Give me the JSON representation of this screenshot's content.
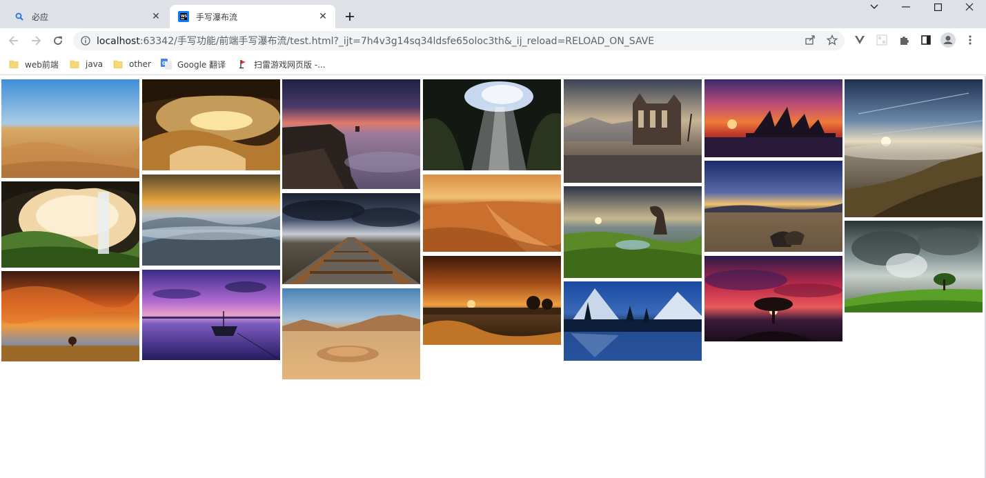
{
  "tabs": [
    {
      "title": "必应",
      "icon": "bing-search-icon"
    },
    {
      "title": "手写瀑布流",
      "icon": "webstorm-icon"
    }
  ],
  "address": {
    "host": "localhost",
    "rest": ":63342/手写功能/前端手写瀑布流/test.html?_ijt=7h4v3g14sq34ldsfe65oloc3th&_ij_reload=RELOAD_ON_SAVE"
  },
  "bookmarks": [
    {
      "label": "web前端",
      "icon": "folder-icon"
    },
    {
      "label": "java",
      "icon": "folder-icon"
    },
    {
      "label": "other",
      "icon": "folder-icon"
    },
    {
      "label": "Google 翻译",
      "icon": "google-translate-icon"
    },
    {
      "label": "扫雷游戏网页版 -...",
      "icon": "minesweeper-flag-icon"
    }
  ],
  "colors": {
    "tabstrip": "#dee1e6",
    "accent": "#1a73e8"
  },
  "gallery": {
    "columns": [
      [
        "desert-dunes",
        "waterfall-cave",
        "sunset-lone-tree"
      ],
      [
        "golden-dunes",
        "misty-valley",
        "purple-lake-boat"
      ],
      [
        "sea-cliffs",
        "railroad-tracks",
        "rocky-desert"
      ],
      [
        "cave-skylight",
        "orange-dunes",
        "african-sunset"
      ],
      [
        "ruined-abbey",
        "mossy-shore",
        "snowy-mountains-lake"
      ],
      [
        "opera-house-sunset",
        "lake-boat-dusk",
        "red-sky-tree"
      ],
      [
        "mountain-sunrise",
        "green-hill-tree"
      ]
    ]
  }
}
